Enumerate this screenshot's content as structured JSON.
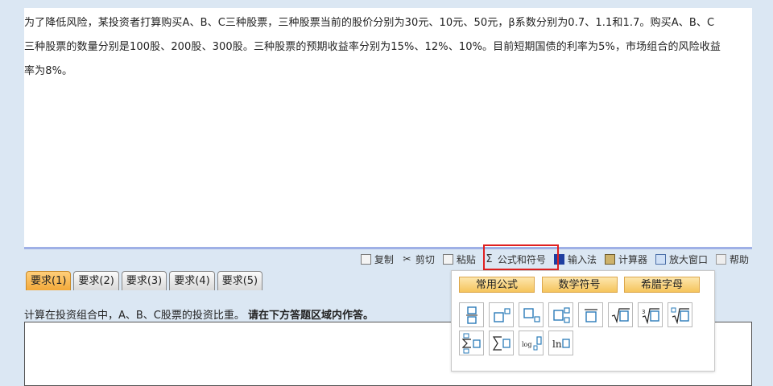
{
  "question": {
    "lines": [
      "为了降低风险，某投资者打算购买A、B、C三种股票，三种股票当前的股价分别为30元、10元、50元，β系数分别为0.7、1.1和1.7。购买A、B、C",
      "三种股票的数量分别是100股、200股、300股。三种股票的预期收益率分别为15%、12%、10%。目前短期国债的利率为5%，市场组合的风险收益",
      "率为8%。"
    ]
  },
  "toolbar": {
    "copy": "复制",
    "cut": "剪切",
    "paste": "粘贴",
    "formula": "公式和符号",
    "input_method": "输入法",
    "calculator": "计算器",
    "enlarge": "放大窗口",
    "help": "帮助"
  },
  "tabs": [
    {
      "label": "要求(1)",
      "active": true
    },
    {
      "label": "要求(2)",
      "active": false
    },
    {
      "label": "要求(3)",
      "active": false
    },
    {
      "label": "要求(4)",
      "active": false
    },
    {
      "label": "要求(5)",
      "active": false
    }
  ],
  "instruction": {
    "text": "计算在投资组合中，A、B、C股票的投资比重。",
    "bold": "请在下方答题区域内作答。"
  },
  "formula_panel": {
    "tabs": [
      "常用公式",
      "数学符号",
      "希腊字母"
    ],
    "row1": [
      "fraction-icon",
      "superscript-icon",
      "subscript-icon",
      "sub-superscript-icon",
      "overline-icon",
      "square-root-icon",
      "cube-root-icon",
      "nth-root-icon"
    ],
    "row2": [
      "summation-limits-icon",
      "summation-icon",
      "logarithm-icon",
      "natural-log-icon"
    ],
    "log_label": "log",
    "ln_label": "ln"
  },
  "colors": {
    "accent_tab": "#f3a93a",
    "highlight": "#e02020",
    "panel_button": "#f5c45c",
    "background": "#dbe7f3"
  }
}
